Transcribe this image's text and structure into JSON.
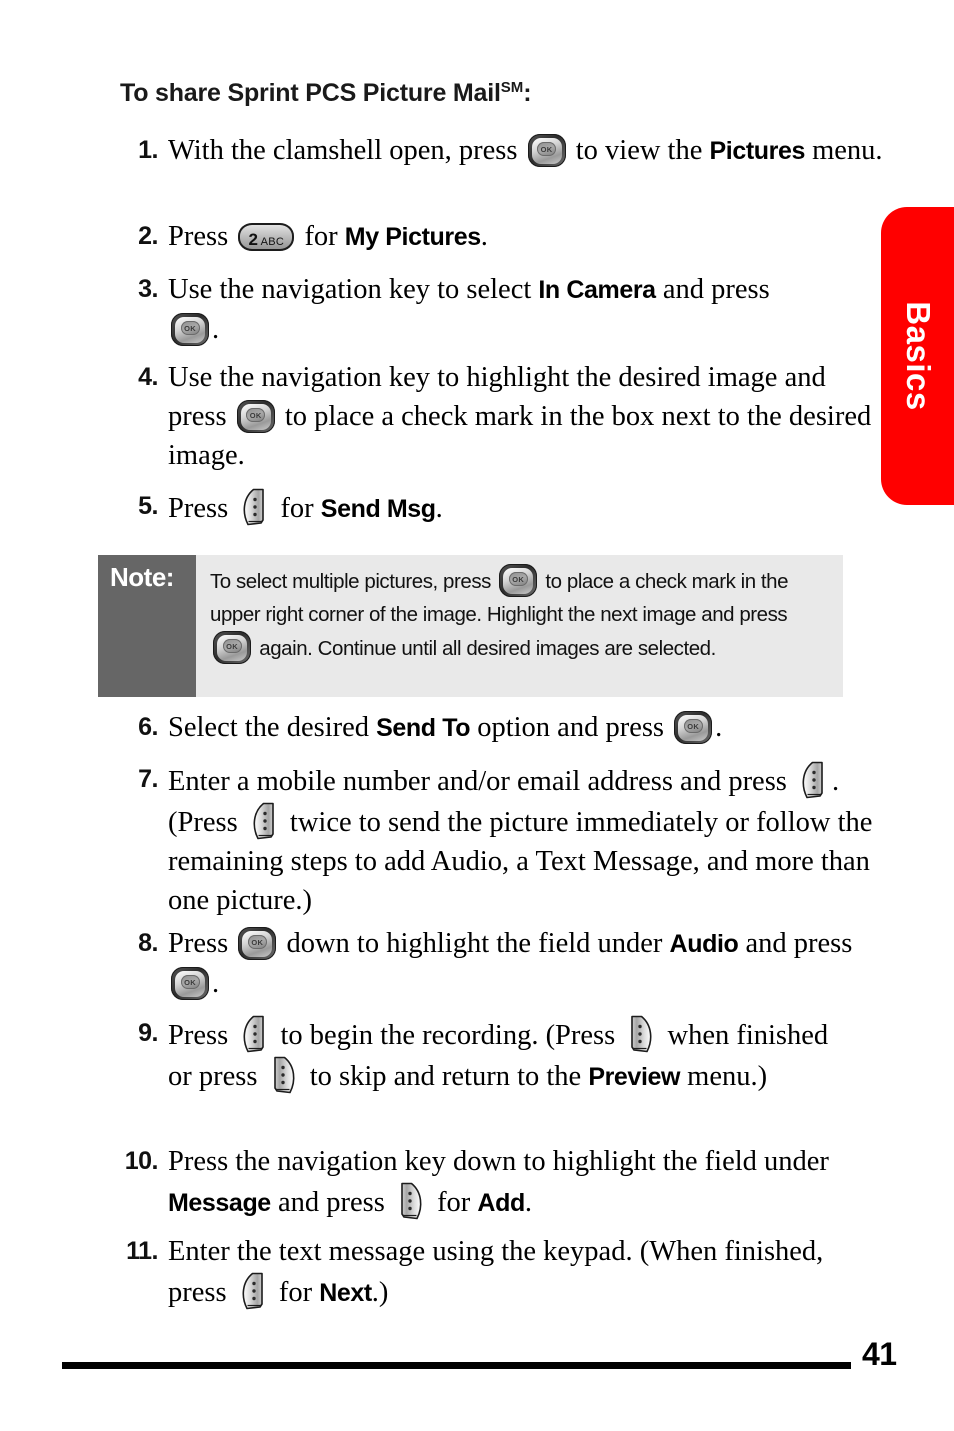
{
  "heading": {
    "text": "To share Sprint PCS Picture Mail",
    "superscript": "SM",
    "trailing": ":"
  },
  "side_tab": {
    "label": "Basics",
    "color": "#ff0000",
    "text_color": "#ffffff"
  },
  "keys": {
    "ok_label": "OK",
    "num_digit": "2",
    "num_letters": "ABC"
  },
  "steps": [
    {
      "number": "1.",
      "segments": [
        {
          "t": "text",
          "v": "With the clamshell open, press "
        },
        {
          "t": "key-ok"
        },
        {
          "t": "text",
          "v": " to view the "
        },
        {
          "t": "bold",
          "v": "Pictures"
        },
        {
          "t": "text",
          "v": " menu."
        }
      ]
    },
    {
      "number": "2.",
      "segments": [
        {
          "t": "text",
          "v": "Press "
        },
        {
          "t": "key-num"
        },
        {
          "t": "text",
          "v": " for "
        },
        {
          "t": "bold",
          "v": "My Pictures"
        },
        {
          "t": "text",
          "v": "."
        }
      ]
    },
    {
      "number": "3.",
      "segments": [
        {
          "t": "text",
          "v": "Use the navigation key to select "
        },
        {
          "t": "bold",
          "v": "In Camera"
        },
        {
          "t": "text",
          "v": " and press "
        },
        {
          "t": "key-ok"
        },
        {
          "t": "text",
          "v": "."
        }
      ]
    },
    {
      "number": "4.",
      "segments": [
        {
          "t": "text",
          "v": "Use the navigation key to highlight the desired image and press "
        },
        {
          "t": "key-ok"
        },
        {
          "t": "text",
          "v": " to place a check mark in the box next to the desired image."
        }
      ]
    },
    {
      "number": "5.",
      "segments": [
        {
          "t": "text",
          "v": "Press "
        },
        {
          "t": "key-soft-left"
        },
        {
          "t": "text",
          "v": " for "
        },
        {
          "t": "bold",
          "v": "Send Msg"
        },
        {
          "t": "text",
          "v": "."
        }
      ]
    },
    {
      "number": "6.",
      "segments": [
        {
          "t": "text",
          "v": "Select the desired "
        },
        {
          "t": "bold",
          "v": "Send To"
        },
        {
          "t": "text",
          "v": " option and press "
        },
        {
          "t": "key-ok"
        },
        {
          "t": "text",
          "v": "."
        }
      ]
    },
    {
      "number": "7.",
      "segments": [
        {
          "t": "text",
          "v": "Enter a mobile number and/or email address and press "
        },
        {
          "t": "key-soft-left"
        },
        {
          "t": "text",
          "v": ". (Press "
        },
        {
          "t": "key-soft-left"
        },
        {
          "t": "text",
          "v": " twice to send the picture immediately or follow the remaining steps to add Audio, a Text Message, and more than one picture.)"
        }
      ]
    },
    {
      "number": "8.",
      "segments": [
        {
          "t": "text",
          "v": "Press "
        },
        {
          "t": "key-ok"
        },
        {
          "t": "text",
          "v": " down to highlight the field under "
        },
        {
          "t": "bold",
          "v": "Audio"
        },
        {
          "t": "text",
          "v": " and press "
        },
        {
          "t": "key-ok"
        },
        {
          "t": "text",
          "v": "."
        }
      ]
    },
    {
      "number": "9.",
      "segments": [
        {
          "t": "text",
          "v": "Press "
        },
        {
          "t": "key-soft-left"
        },
        {
          "t": "text",
          "v": " to begin the recording. (Press "
        },
        {
          "t": "key-soft-right"
        },
        {
          "t": "text",
          "v": " when finished or press "
        },
        {
          "t": "key-soft-right"
        },
        {
          "t": "text",
          "v": " to skip and return to the "
        },
        {
          "t": "bold",
          "v": "Preview"
        },
        {
          "t": "text",
          "v": " menu.)"
        }
      ]
    },
    {
      "number": "10.",
      "segments": [
        {
          "t": "text",
          "v": "Press the navigation key down to highlight the field under "
        },
        {
          "t": "bold",
          "v": "Message"
        },
        {
          "t": "text",
          "v": " and press "
        },
        {
          "t": "key-soft-right"
        },
        {
          "t": "text",
          "v": " for "
        },
        {
          "t": "bold",
          "v": "Add"
        },
        {
          "t": "text",
          "v": "."
        }
      ]
    },
    {
      "number": "11.",
      "segments": [
        {
          "t": "text",
          "v": "Enter the text message using the keypad. (When finished, press "
        },
        {
          "t": "key-soft-left"
        },
        {
          "t": "text",
          "v": " for "
        },
        {
          "t": "bold",
          "v": "Next"
        },
        {
          "t": "text",
          "v": ".)"
        }
      ]
    }
  ],
  "note": {
    "label": "Note:",
    "segments": [
      {
        "t": "text",
        "v": "To select multiple pictures, press "
      },
      {
        "t": "key-ok"
      },
      {
        "t": "text",
        "v": " to place a check mark in the upper right corner of the image. Highlight the next image and press "
      },
      {
        "t": "key-ok"
      },
      {
        "t": "text",
        "v": " again.  Continue until all desired images are selected."
      }
    ]
  },
  "footer": {
    "page_number": "41"
  }
}
